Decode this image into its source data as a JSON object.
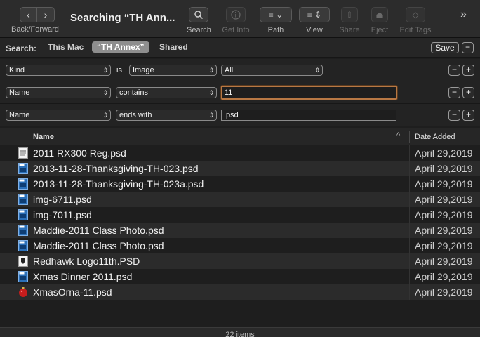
{
  "toolbar": {
    "back_label": "Back/Forward",
    "title": "Searching “TH Ann...",
    "search_label": "Search",
    "getinfo_label": "Get Info",
    "path_label": "Path",
    "view_label": "View",
    "share_label": "Share",
    "eject_label": "Eject",
    "edittags_label": "Edit Tags"
  },
  "scope": {
    "label": "Search:",
    "this_mac": "This Mac",
    "th_annex": "“TH Annex”",
    "shared": "Shared",
    "save": "Save",
    "minus": "−"
  },
  "criteria": [
    {
      "attr": "Kind",
      "op": "is",
      "value": "Image",
      "value2": "All"
    },
    {
      "attr": "Name",
      "op": "contains",
      "value": "11"
    },
    {
      "attr": "Name",
      "op": "ends with",
      "value": ".psd"
    }
  ],
  "buttons": {
    "minus": "−",
    "plus": "+"
  },
  "list": {
    "col_name": "Name",
    "col_date": "Date Added",
    "sort_indicator": "^"
  },
  "files": [
    {
      "name": "2011 RX300 Reg.psd",
      "date": "April 29,2019",
      "icon": "doc-icon"
    },
    {
      "name": "2013-11-28-Thanksgiving-TH-023.psd",
      "date": "April 29,2019",
      "icon": "psd-icon"
    },
    {
      "name": "2013-11-28-Thanksgiving-TH-023a.psd",
      "date": "April 29,2019",
      "icon": "psd-icon"
    },
    {
      "name": "img-6711.psd",
      "date": "April 29,2019",
      "icon": "psd-icon"
    },
    {
      "name": "img-7011.psd",
      "date": "April 29,2019",
      "icon": "psd-icon"
    },
    {
      "name": "Maddie-2011 Class Photo.psd",
      "date": "April 29,2019",
      "icon": "psd-icon"
    },
    {
      "name": "Maddie-2011 Class Photo.psd",
      "date": "April 29,2019",
      "icon": "psd-icon"
    },
    {
      "name": "Redhawk Logo11th.PSD",
      "date": "April 29,2019",
      "icon": "logo-icon"
    },
    {
      "name": "Xmas Dinner 2011.psd",
      "date": "April 29,2019",
      "icon": "psd-icon"
    },
    {
      "name": "XmasOrna-11.psd",
      "date": "April 29,2019",
      "icon": "ornament-icon"
    }
  ],
  "status": "22 items",
  "colors": {
    "accent_focus": "#b87844",
    "psd_blue": "#2a6fb8"
  }
}
